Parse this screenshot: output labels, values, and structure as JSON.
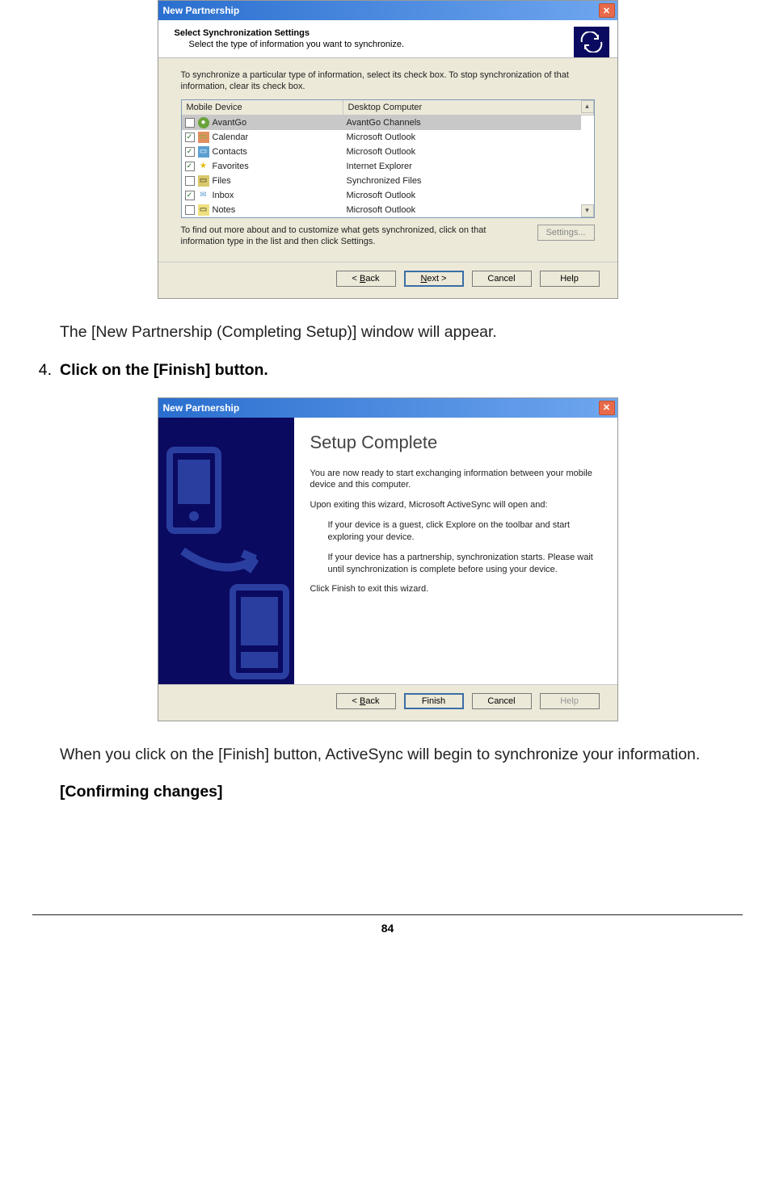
{
  "dialog1": {
    "title": "New Partnership",
    "header_title": "Select Synchronization Settings",
    "header_sub": "Select the type of information you want to synchronize.",
    "intro_text": "To synchronize a particular type of information, select its check box. To stop synchronization of that information, clear its check box.",
    "col_mobile": "Mobile Device",
    "col_desktop": "Desktop Computer",
    "rows": [
      {
        "checked": false,
        "selected": true,
        "icon": "ic-globe",
        "name": "AvantGo",
        "desktop": "AvantGo Channels"
      },
      {
        "checked": true,
        "selected": false,
        "icon": "ic-cal",
        "name": "Calendar",
        "desktop": "Microsoft Outlook"
      },
      {
        "checked": true,
        "selected": false,
        "icon": "ic-card",
        "name": "Contacts",
        "desktop": "Microsoft Outlook"
      },
      {
        "checked": true,
        "selected": false,
        "icon": "ic-star",
        "name": "Favorites",
        "desktop": "Internet Explorer"
      },
      {
        "checked": false,
        "selected": false,
        "icon": "ic-folder",
        "name": "Files",
        "desktop": "Synchronized Files"
      },
      {
        "checked": true,
        "selected": false,
        "icon": "ic-env",
        "name": "Inbox",
        "desktop": "Microsoft Outlook"
      },
      {
        "checked": false,
        "selected": false,
        "icon": "ic-note",
        "name": "Notes",
        "desktop": "Microsoft Outlook"
      }
    ],
    "settings_text": "To find out more about and to customize what gets synchronized, click on that information type in the list and then click Settings.",
    "settings_btn": "Settings...",
    "btn_back": "< Back",
    "btn_next": "Next >",
    "btn_cancel": "Cancel",
    "btn_help": "Help"
  },
  "doc": {
    "after_d1": "The [New Partnership (Completing Setup)] window will appear.",
    "step_num": "4.",
    "step_text": "Click on the [Finish] button.",
    "after_d2": "When you click on the [Finish] button, ActiveSync will begin to synchronize your information.",
    "confirm_heading": "[Confirming changes]",
    "page_num": "84"
  },
  "dialog2": {
    "title": "New Partnership",
    "setup_title": "Setup Complete",
    "p1": "You are now ready to start exchanging information between your mobile device and this computer.",
    "p2": "Upon exiting this wizard, Microsoft ActiveSync will open and:",
    "p3": "If your device is a guest, click Explore on the toolbar and start exploring your device.",
    "p4": "If your device has a partnership, synchronization starts. Please wait until synchronization is complete before using your device.",
    "p5": "Click Finish to exit this wizard.",
    "btn_back": "< Back",
    "btn_finish": "Finish",
    "btn_cancel": "Cancel",
    "btn_help": "Help"
  }
}
